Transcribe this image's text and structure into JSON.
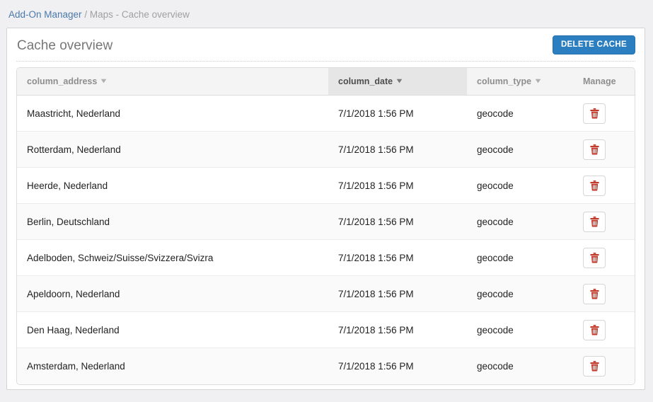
{
  "breadcrumb": {
    "link_label": "Add-On Manager",
    "separator": " / ",
    "current": "Maps - Cache overview"
  },
  "panel": {
    "title": "Cache overview",
    "delete_cache_label": "DELETE CACHE",
    "accent_color": "#2b7fc1",
    "danger_color": "#c0392b"
  },
  "table": {
    "columns": [
      {
        "key": "address",
        "label": "column_address",
        "sortable": true,
        "sorted": false,
        "icon": "chevron-down-icon"
      },
      {
        "key": "date",
        "label": "column_date",
        "sortable": true,
        "sorted": true,
        "icon": "chevron-down-icon"
      },
      {
        "key": "type",
        "label": "column_type",
        "sortable": true,
        "sorted": false,
        "icon": "chevron-down-icon"
      },
      {
        "key": "manage",
        "label": "Manage",
        "sortable": false,
        "sorted": false,
        "icon": ""
      }
    ],
    "rows": [
      {
        "address": "Maastricht, Nederland",
        "date": "7/1/2018 1:56 PM",
        "type": "geocode",
        "delete_icon": "trash-icon"
      },
      {
        "address": "Rotterdam, Nederland",
        "date": "7/1/2018 1:56 PM",
        "type": "geocode",
        "delete_icon": "trash-icon"
      },
      {
        "address": "Heerde, Nederland",
        "date": "7/1/2018 1:56 PM",
        "type": "geocode",
        "delete_icon": "trash-icon"
      },
      {
        "address": "Berlin, Deutschland",
        "date": "7/1/2018 1:56 PM",
        "type": "geocode",
        "delete_icon": "trash-icon"
      },
      {
        "address": "Adelboden, Schweiz/Suisse/Svizzera/Svizra",
        "date": "7/1/2018 1:56 PM",
        "type": "geocode",
        "delete_icon": "trash-icon"
      },
      {
        "address": "Apeldoorn, Nederland",
        "date": "7/1/2018 1:56 PM",
        "type": "geocode",
        "delete_icon": "trash-icon"
      },
      {
        "address": "Den Haag, Nederland",
        "date": "7/1/2018 1:56 PM",
        "type": "geocode",
        "delete_icon": "trash-icon"
      },
      {
        "address": "Amsterdam, Nederland",
        "date": "7/1/2018 1:56 PM",
        "type": "geocode",
        "delete_icon": "trash-icon"
      }
    ]
  }
}
